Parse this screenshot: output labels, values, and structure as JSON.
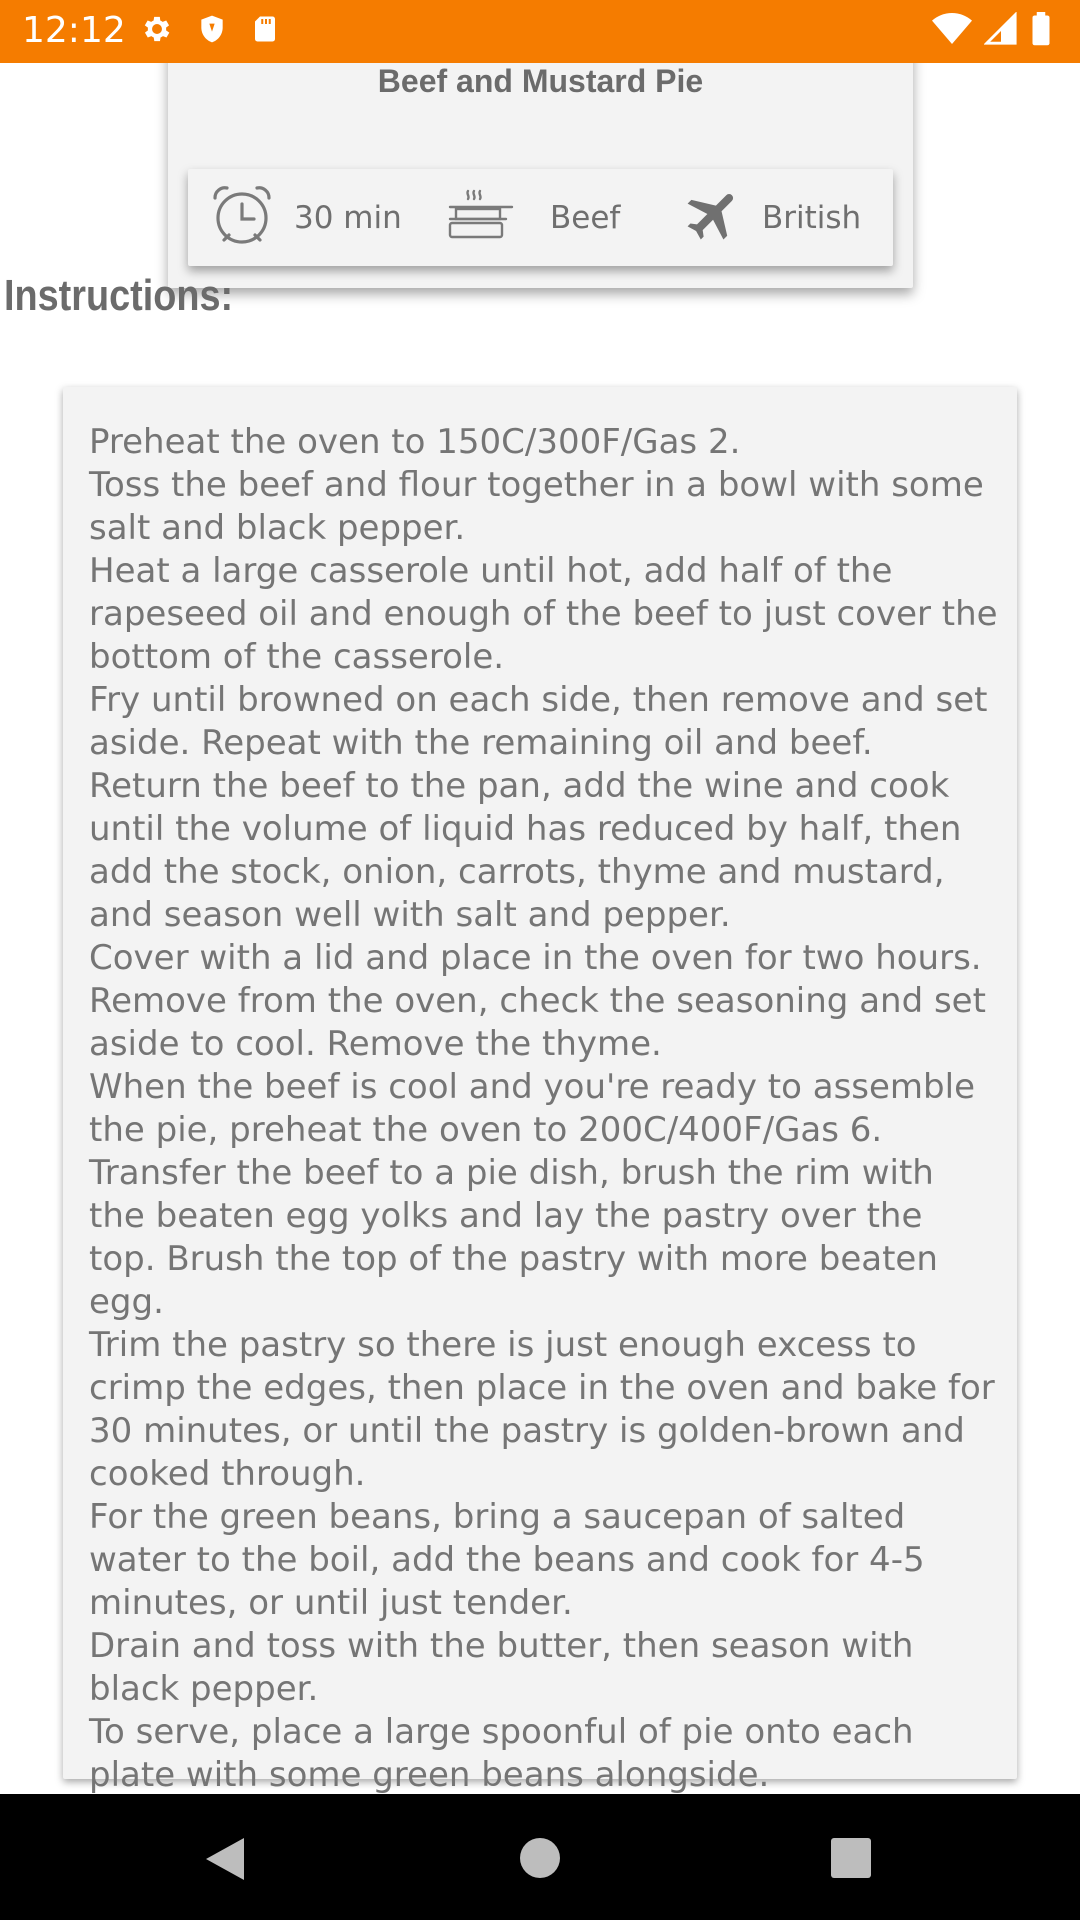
{
  "status_bar": {
    "time": "12:12",
    "left_icons": [
      "gear-icon",
      "shield-icon",
      "sd-card-icon"
    ],
    "right_icons": [
      "wifi-icon",
      "cell-signal-icon",
      "battery-icon"
    ],
    "background_color": "#f57c00"
  },
  "recipe": {
    "title": "Beef and Mustard Pie",
    "time": "30 min",
    "category": "Beef",
    "area": "British"
  },
  "instructions": {
    "heading": "Instructions:",
    "text": "Preheat the oven to 150C/300F/Gas 2.\nToss the beef and flour together in a bowl with some salt and black pepper.\nHeat a large casserole until hot, add half of the rapeseed oil and enough of the beef to just cover the bottom of the casserole.\nFry until browned on each side, then remove and set aside. Repeat with the remaining oil and beef.\nReturn the beef to the pan, add the wine and cook until the volume of liquid has reduced by half, then add the stock, onion, carrots, thyme and mustard, and season well with salt and pepper.\nCover with a lid and place in the oven for two hours.\nRemove from the oven, check the seasoning and set aside to cool. Remove the thyme.\nWhen the beef is cool and you're ready to assemble the pie, preheat the oven to 200C/400F/Gas 6.\nTransfer the beef to a pie dish, brush the rim with the beaten egg yolks and lay the pastry over the top. Brush the top of the pastry with more beaten egg.\nTrim the pastry so there is just enough excess to crimp the edges, then place in the oven and bake for 30 minutes, or until the pastry is golden-brown and cooked through.\nFor the green beans, bring a saucepan of salted water to the boil, add the beans and cook for 4-5 minutes, or until just tender.\nDrain and toss with the butter, then season with black pepper.\nTo serve, place a large spoonful of pie onto each plate with some green beans alongside."
  },
  "nav_bar": {
    "buttons": [
      "back-icon",
      "home-icon",
      "recents-icon"
    ]
  }
}
